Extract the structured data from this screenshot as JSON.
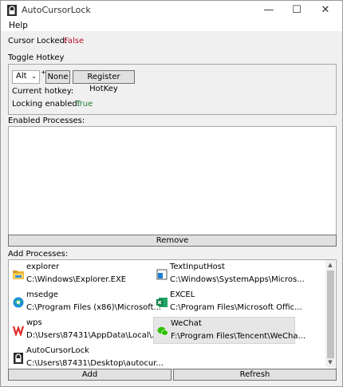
{
  "window": {
    "title": "AutoCursorLock",
    "controls": {
      "minimize": "—",
      "maximize": "☐",
      "close": "✕"
    }
  },
  "menu": {
    "help": "Help"
  },
  "status": {
    "cursor_locked_label": "Cursor Locked:",
    "cursor_locked_value": "False"
  },
  "hotkey_section": {
    "title": "Toggle Hotkey",
    "modifier_value": "Alt",
    "plus": "+",
    "key_button": "None",
    "register_button": "Register HotKey",
    "current_hotkey_label": "Current hotkey:",
    "locking_enabled_label": "Locking enabled:",
    "locking_enabled_value": "True"
  },
  "enabled_processes": {
    "title": "Enabled Processes:",
    "remove_button": "Remove",
    "items": []
  },
  "add_processes": {
    "title": "Add Processes:",
    "add_button": "Add",
    "refresh_button": "Refresh",
    "items": [
      {
        "name": "explorer",
        "path": "C:\\Windows\\Explorer.EXE",
        "icon": "folder-icon"
      },
      {
        "name": "TextInputHost",
        "path": "C:\\Windows\\SystemApps\\Micros...",
        "icon": "textinputhost-icon"
      },
      {
        "name": "msedge",
        "path": "C:\\Program Files (x86)\\Microsoft...",
        "icon": "edge-icon"
      },
      {
        "name": "EXCEL",
        "path": "C:\\Program Files\\Microsoft Offic...",
        "icon": "excel-icon"
      },
      {
        "name": "wps",
        "path": "D:\\Users\\87431\\AppData\\Local\\...",
        "icon": "wps-icon"
      },
      {
        "name": "WeChat",
        "path": "F:\\Program Files\\Tencent\\WeCha...",
        "icon": "wechat-icon",
        "selected": true
      },
      {
        "name": "AutoCursorLock",
        "path": "C:\\Users\\87431\\Desktop\\autocur...",
        "icon": "lock-app-icon"
      }
    ]
  },
  "colors": {
    "false_red": "#b8112c",
    "true_green": "#1d7f33",
    "window_bg": "#f0f0f0"
  }
}
